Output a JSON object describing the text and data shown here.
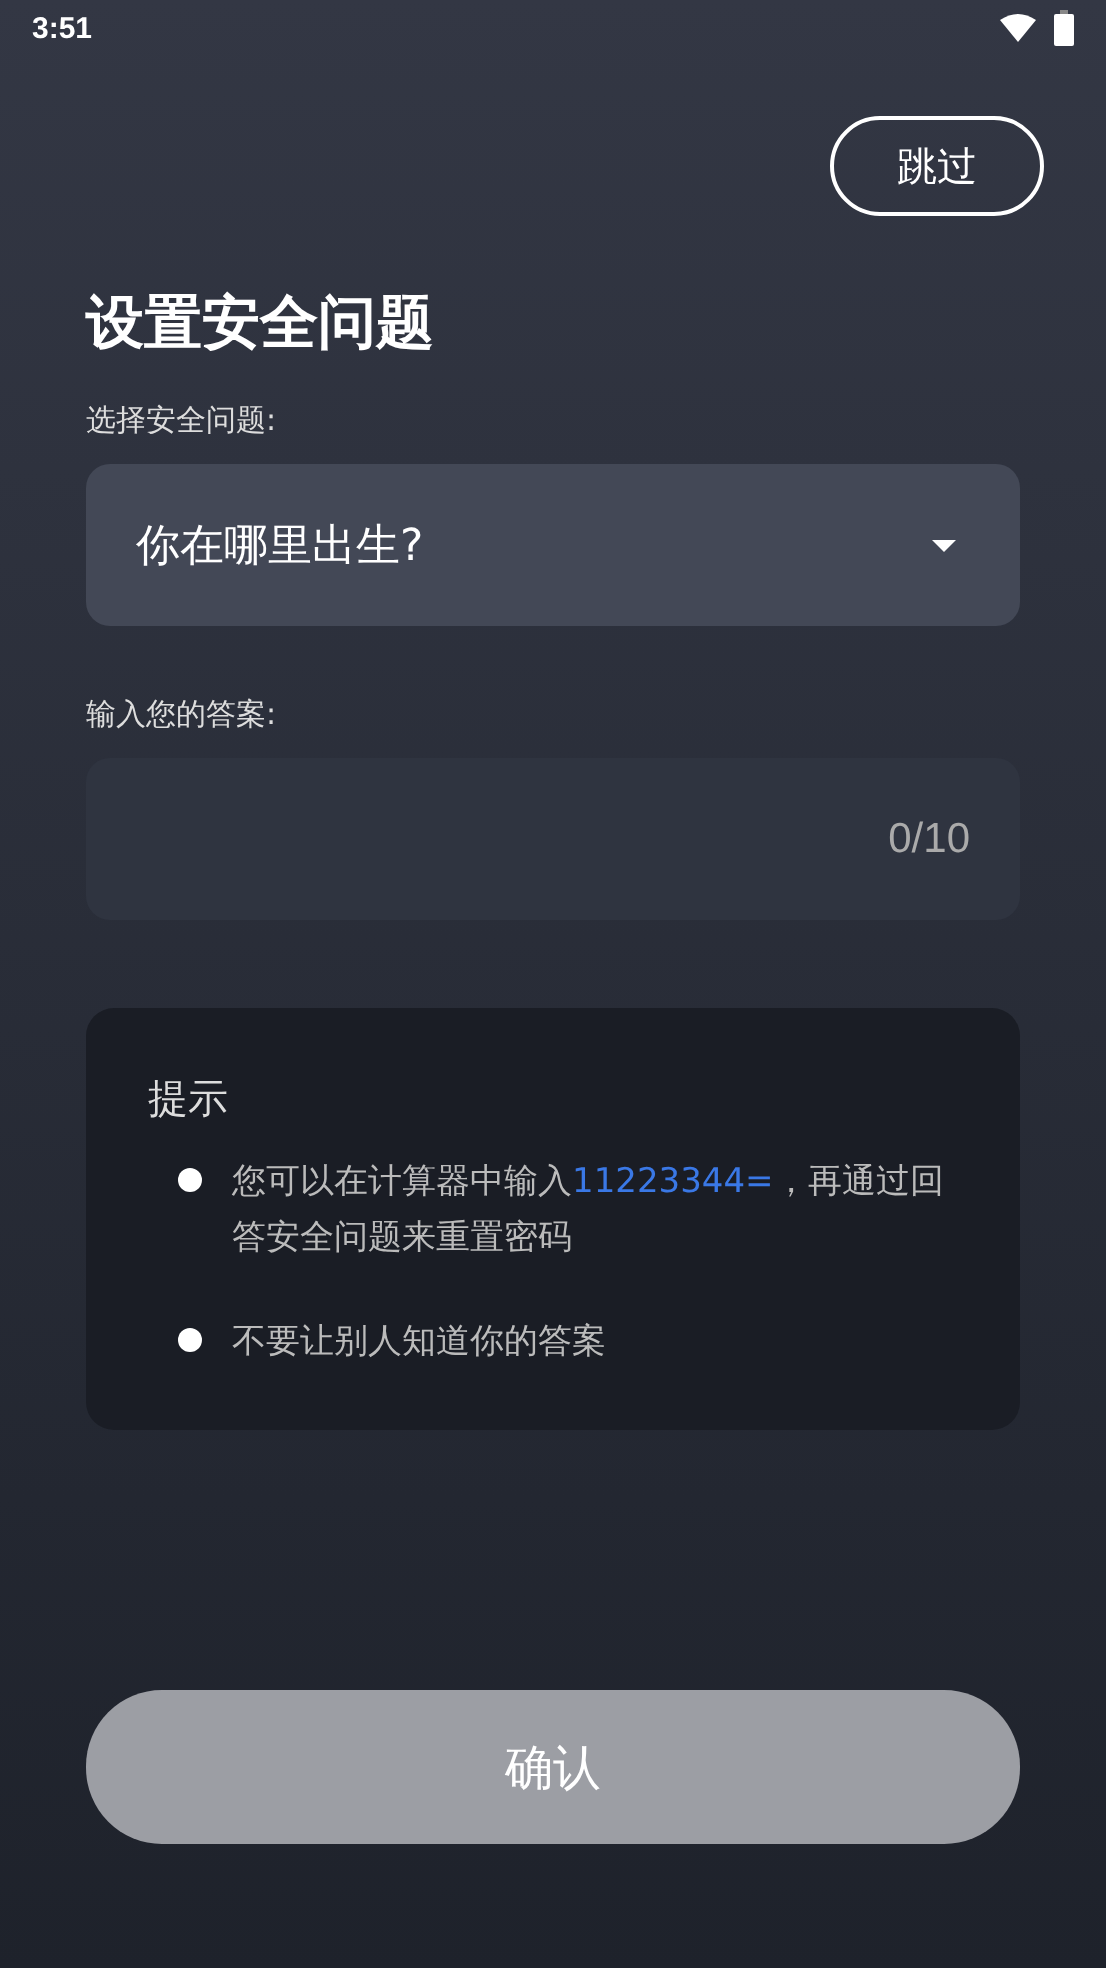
{
  "status_bar": {
    "time": "3:51"
  },
  "skip_button": {
    "label": "跳过"
  },
  "title": "设置安全问题",
  "question": {
    "label": "选择安全问题:",
    "value": "你在哪里出生?"
  },
  "answer": {
    "label": "输入您的答案:",
    "counter": "0/10"
  },
  "tips": {
    "title": "提示",
    "items": [
      {
        "parts": [
          {
            "kind": "plain",
            "text": "您可以在计算器中输入"
          },
          {
            "kind": "highlight",
            "text": "11223344="
          },
          {
            "kind": "plain",
            "text": "，再通过回答安全问题来重置密码"
          }
        ]
      },
      {
        "parts": [
          {
            "kind": "plain",
            "text": "不要让别人知道你的答案"
          }
        ]
      }
    ]
  },
  "confirm_button": {
    "label": "确认",
    "disabled": true
  }
}
